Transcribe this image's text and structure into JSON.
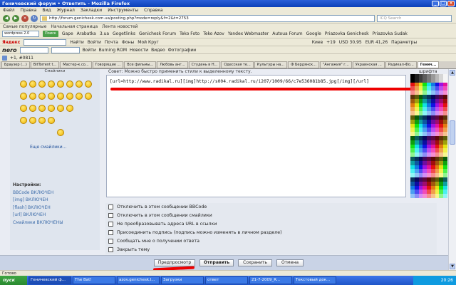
{
  "window": {
    "title": "Геничевский форум • Ответить - Mozilla Firefox"
  },
  "menu": [
    "Файл",
    "Правка",
    "Вид",
    "Журнал",
    "Закладки",
    "Инструменты",
    "Справка"
  ],
  "nav": {
    "url": "http://forum.genichesk.com.ua/posting.php?mode=reply&f=2&t=2753",
    "search_placeholder": "ICQ Search"
  },
  "bookmarks": [
    "Самые популярные",
    "Начальная страница",
    "Лента новостей"
  ],
  "toolbar1": {
    "search_value": "wordpress 2.0",
    "search_btn": "Поиск",
    "links": [
      "Gape",
      "Arabatka",
      "3.ua",
      "Gogetlinks",
      "Genichesk Forum",
      "Teko Foto",
      "Teko Azov",
      "Yandex Webmaster",
      "Autoua Forum",
      "Google",
      "Priazovka Genichesk",
      "Priazovka Sudak"
    ]
  },
  "toolbar2": {
    "label": "Яндекс",
    "find": "Найти",
    "items": [
      "Войти",
      "Почта",
      "Фоны",
      "Мой Круг"
    ],
    "stats": "Киев",
    "temp": "+19",
    "usd": "USD 30,95",
    "eur": "EUR 41,26",
    "params": "Параметры"
  },
  "toolbar3": {
    "items": [
      "Войти",
      "Burning ROM",
      "Новости",
      "Видео",
      "Фотографии"
    ]
  },
  "toolbar4": {
    "counter": "+1,  #0811"
  },
  "tabs": [
    "Браузер (...)",
    "BitTorrent t...",
    "Мастер-к.со...",
    "Говорящие ...",
    "Все фильмы...",
    "Любовь анг...",
    "Студень в Н...",
    "Одесская те...",
    "Культуры на...",
    "Ф Бердянск...",
    "\"Ангажия\" г...",
    "Украинская ...",
    "Радикал-Фо...",
    "Генич..."
  ],
  "page": {
    "smileys_title": "Смайлики",
    "more_smileys": "Еще смайлики...",
    "hint": "Совет: Можно быстро применить стили к выделенному тексту.",
    "palette_label": "шрифта",
    "post_text": "[url=http://www.radikal.ru][img]http://s004.radikal.ru/i207/1009/66/c7e536081b85.jpg[/img][/url]",
    "settings_head": "Настройки:",
    "settings": [
      "BBCode ВКЛЮЧЕН",
      "[img] ВКЛЮЧЕН",
      "[flash] ВКЛЮЧЕН",
      "[url] ВКЛЮЧЕН",
      "Смайлики ВКЛЮЧЕНЫ"
    ],
    "options": [
      "Отключить в этом сообщении BBCode",
      "Отключить в этом сообщении смайлики",
      "Не преобразовывать адреса URL в ссылки",
      "Присоединить подпись (подпись можно изменять в личном разделе)",
      "Сообщать мне о получении ответа",
      "Закрыть тему"
    ],
    "buttons": {
      "preview": "Предпросмотр",
      "submit": "Отправить",
      "save": "Сохранить",
      "cancel": "Отмена"
    }
  },
  "status": "Готово",
  "taskbar": {
    "start": "пуск",
    "items": [
      "Геничевский ф...",
      "The Bat!",
      "azov.genichesk.l...",
      "Загрузки",
      "ответ",
      "21-7-2009_R...",
      "Текстовый док..."
    ],
    "clock": "20:26"
  }
}
